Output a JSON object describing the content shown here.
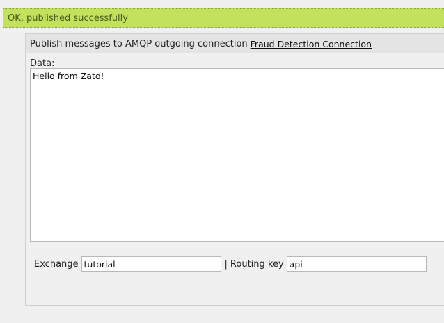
{
  "notice": {
    "message": "OK, published successfully",
    "color": "#c2e15c"
  },
  "panel": {
    "title_prefix": "Publish messages to AMQP outgoing connection",
    "connection_link": "Fraud Detection Connection",
    "data_label": "Data:",
    "data_value": "Hello from Zato!",
    "exchange_label": "Exchange",
    "exchange_value": "tutorial",
    "separator": "|",
    "routing_key_label": "Routing key",
    "routing_key_value": "api"
  }
}
